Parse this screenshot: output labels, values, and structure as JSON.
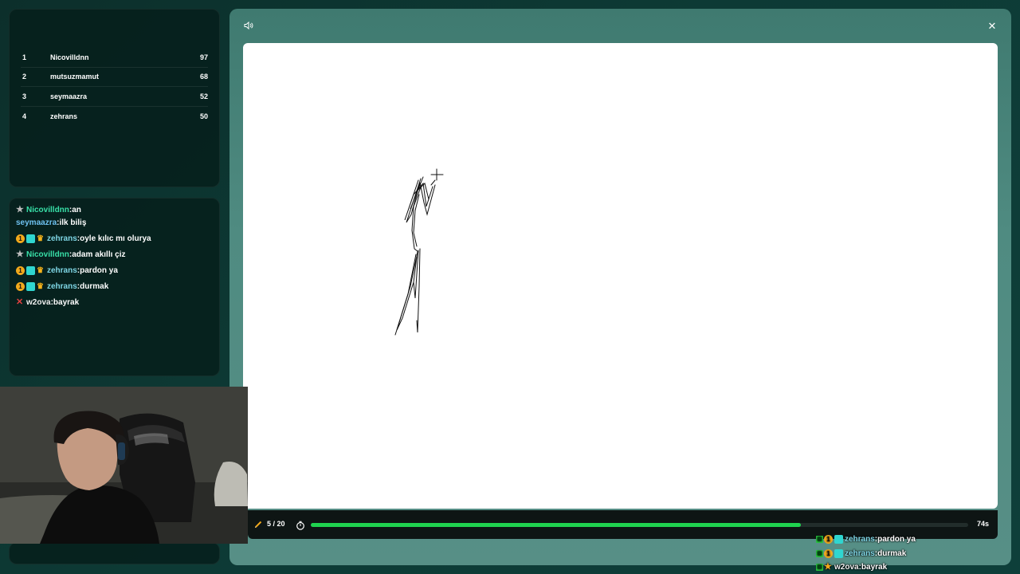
{
  "leaderboard": [
    {
      "rank": "1",
      "name": "Nicovilldnn",
      "score": "97"
    },
    {
      "rank": "2",
      "name": "mutsuzmamut",
      "score": "68"
    },
    {
      "rank": "3",
      "name": "seymaazra",
      "score": "52"
    },
    {
      "rank": "4",
      "name": "zehrans",
      "score": "50"
    }
  ],
  "chat": {
    "partial": {
      "user": "Nicovilldnn",
      "text": "an"
    },
    "messages": [
      {
        "user": "seymaazra",
        "text": "ilk biliş"
      },
      {
        "user": "zehrans",
        "text": "oyle kılıc mı olurya"
      },
      {
        "user": "Nicovilldnn",
        "text": "adam akıllı çiz"
      },
      {
        "user": "zehrans",
        "text": "pardon ya"
      },
      {
        "user": "zehrans",
        "text": "durmak"
      },
      {
        "user": "w2ova",
        "text": "bayrak"
      }
    ],
    "badge_number": "1"
  },
  "game": {
    "round": "5 / 20",
    "time_left": "74s",
    "progress": 0.745,
    "accent_color": "#1fd34f",
    "icons": {
      "sound": "speaker-icon",
      "close": "close-icon",
      "pencil": "pencil-icon",
      "timer": "timer-icon"
    }
  },
  "overlay_chat": [
    {
      "user": "zehrans",
      "sep": " : ",
      "text": "pardon ya"
    },
    {
      "user": "zehrans",
      "sep": " : ",
      "text": "durmak"
    },
    {
      "user": "w2ova",
      "sep": " : ",
      "text": "bayrak"
    }
  ]
}
